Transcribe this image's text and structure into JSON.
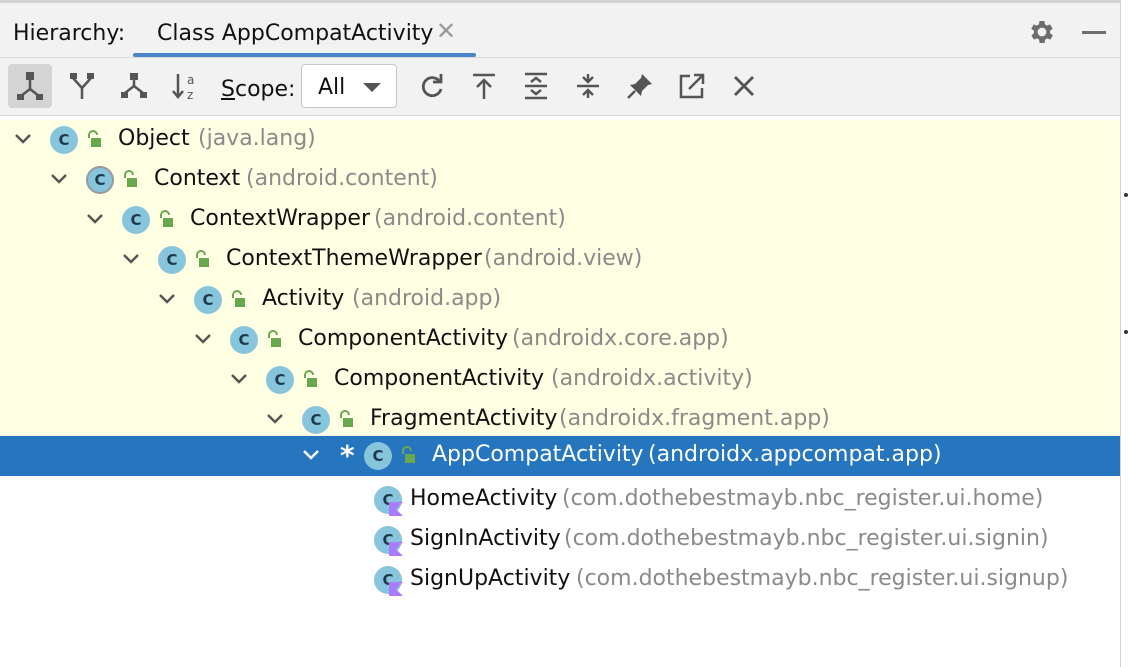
{
  "header": {
    "hierarchy_label": "Hierarchy:",
    "tab_label": "Class AppCompatActivity",
    "tab_close_icon": "close-icon",
    "settings_icon": "gear-icon",
    "minimize_icon": "minimize-icon"
  },
  "toolbar": {
    "buttons": [
      {
        "icon": "supertypes-hierarchy-icon",
        "active": true
      },
      {
        "icon": "subtypes-hierarchy-icon"
      },
      {
        "icon": "type-hierarchy-icon"
      },
      {
        "icon": "sort-alphabetically-icon"
      }
    ],
    "scope_label_underlined": "S",
    "scope_label_rest": "cope:",
    "scope_value": "All",
    "actions": [
      {
        "icon": "refresh-icon"
      },
      {
        "icon": "scroll-to-top-icon"
      },
      {
        "icon": "expand-all-icon"
      },
      {
        "icon": "collapse-all-icon"
      },
      {
        "icon": "pin-icon"
      },
      {
        "icon": "open-in-editor-icon"
      },
      {
        "icon": "close-icon"
      }
    ]
  },
  "colors": {
    "selected_row": "#2675bf",
    "supertype_bg": "#ffffe4",
    "class_icon": "#87c5dd",
    "tab_underline": "#4a86c8"
  },
  "tree": [
    {
      "name": "Object",
      "package": "(java.lang)"
    },
    {
      "name": "Context",
      "package": "(android.content)"
    },
    {
      "name": "ContextWrapper",
      "package": "(android.content)"
    },
    {
      "name": "ContextThemeWrapper",
      "package": "(android.view)"
    },
    {
      "name": "Activity",
      "package": "(android.app)"
    },
    {
      "name": "ComponentActivity",
      "package": "(androidx.core.app)"
    },
    {
      "name": "ComponentActivity",
      "package": "(androidx.activity)"
    },
    {
      "name": "FragmentActivity",
      "package": "(androidx.fragment.app)"
    },
    {
      "name": "AppCompatActivity",
      "package": "(androidx.appcompat.app)",
      "marker": "*",
      "selected": true
    },
    {
      "name": "HomeActivity",
      "package": "(com.dothebestmayb.nbc_register.ui.home)"
    },
    {
      "name": "SignInActivity",
      "package": "(com.dothebestmayb.nbc_register.ui.signin)"
    },
    {
      "name": "SignUpActivity",
      "package": "(com.dothebestmayb.nbc_register.ui.signup)"
    }
  ]
}
